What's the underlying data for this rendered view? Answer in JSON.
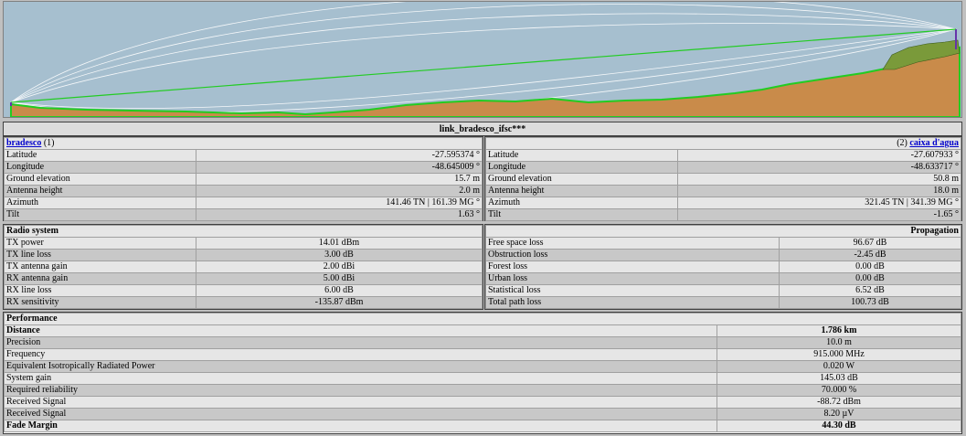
{
  "link_title": "link_bradesco_ifsc***",
  "site_a": {
    "name": "bradesco",
    "index": "(1)",
    "rows": [
      {
        "label": "Latitude",
        "value": "-27.595374 °"
      },
      {
        "label": "Longitude",
        "value": "-48.645009 °"
      },
      {
        "label": "Ground elevation",
        "value": "15.7 m"
      },
      {
        "label": "Antenna height",
        "value": "2.0 m"
      },
      {
        "label": "Azimuth",
        "value": "141.46 TN | 161.39 MG °"
      },
      {
        "label": "Tilt",
        "value": "1.63 °"
      }
    ]
  },
  "site_b": {
    "name": "caixa d'agua",
    "index": "(2)",
    "rows": [
      {
        "label": "Latitude",
        "value": "-27.607933 °"
      },
      {
        "label": "Longitude",
        "value": "-48.633717 °"
      },
      {
        "label": "Ground elevation",
        "value": "50.8 m"
      },
      {
        "label": "Antenna height",
        "value": "18.0 m"
      },
      {
        "label": "Azimuth",
        "value": "321.45 TN | 341.39 MG °"
      },
      {
        "label": "Tilt",
        "value": "-1.65 °"
      }
    ]
  },
  "radio": {
    "heading": "Radio system",
    "rows": [
      {
        "label": "TX power",
        "value": "14.01 dBm"
      },
      {
        "label": "TX line loss",
        "value": "3.00 dB"
      },
      {
        "label": "TX antenna gain",
        "value": "2.00 dBi"
      },
      {
        "label": "RX antenna gain",
        "value": "5.00 dBi"
      },
      {
        "label": "RX line loss",
        "value": "6.00 dB"
      },
      {
        "label": "RX sensitivity",
        "value": "-135.87 dBm"
      }
    ]
  },
  "propagation": {
    "heading": "Propagation",
    "rows": [
      {
        "label": "Free space loss",
        "value": "96.67 dB"
      },
      {
        "label": "Obstruction loss",
        "value": "-2.45 dB"
      },
      {
        "label": "Forest loss",
        "value": "0.00 dB"
      },
      {
        "label": "Urban loss",
        "value": "0.00 dB"
      },
      {
        "label": "Statistical loss",
        "value": "6.52 dB"
      },
      {
        "label": "Total path loss",
        "value": "100.73 dB"
      }
    ]
  },
  "performance": {
    "heading": "Performance",
    "rows": [
      {
        "label": "Distance",
        "value": "1.786 km",
        "bold": true
      },
      {
        "label": "Precision",
        "value": "10.0 m"
      },
      {
        "label": "Frequency",
        "value": "915.000 MHz"
      },
      {
        "label": "Equivalent Isotropically Radiated Power",
        "value": "0.020 W"
      },
      {
        "label": "System gain",
        "value": "145.03 dB"
      },
      {
        "label": "Required reliability",
        "value": "70.000 %"
      },
      {
        "label": "Received Signal",
        "value": "-88.72 dBm"
      },
      {
        "label": "Received Signal",
        "value": "8.20 µV"
      },
      {
        "label": "Fade Margin",
        "value": "44.30 dB",
        "bold": true
      }
    ]
  },
  "colors": {
    "sky": "#a6bfcf",
    "terrain": "#c98b4a",
    "terrain_edge": "#22cc22",
    "los": "#22cc22",
    "fresnel": "#ffffff",
    "forest": "#7a9a3a"
  }
}
